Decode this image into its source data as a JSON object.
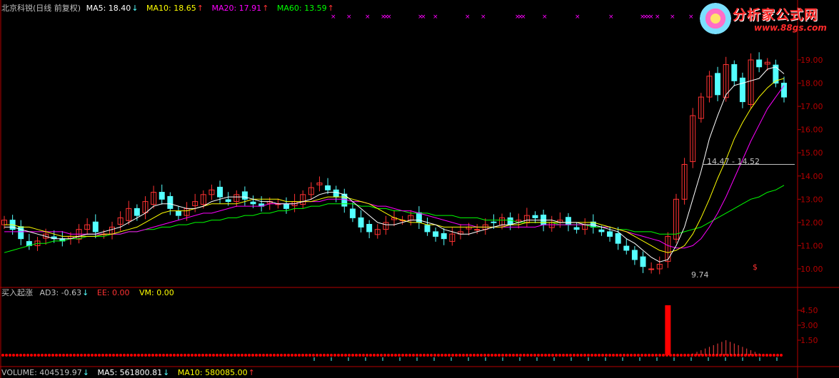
{
  "header": {
    "title": "北京科锐(日线 前复权)",
    "ma5": "MA5: 18.40",
    "ma5_arrow": "↓",
    "ma10": "MA10: 18.65",
    "ma10_arrow": "↑",
    "ma20": "MA20: 17.91",
    "ma20_arrow": "↑",
    "ma60": "MA60: 13.59",
    "ma60_arrow": "↑"
  },
  "indicator_header": {
    "name": "买入起涨",
    "ad3": "AD3: -0.63",
    "ad3_arrow": "↓",
    "ee": "EE: 0.00",
    "vm": "VM: 0.00"
  },
  "volume_header": {
    "volume": "VOLUME: 404519.97",
    "volume_arrow": "↓",
    "ma5": "MA5: 561800.81",
    "ma5_arrow": "↓",
    "ma10": "MA10: 580085.00",
    "ma10_arrow": "↑"
  },
  "logo": {
    "title": "分析家公式网",
    "url": "www.88gs.com"
  },
  "colors": {
    "ma5": "#ffffff",
    "ma10": "#ffff00",
    "ma20": "#ff00ff",
    "ma60": "#00ff00",
    "up": "#ff3232",
    "down": "#54ffff",
    "axis": "#b40000",
    "indicator": "#ff0000"
  },
  "chart_data": [
    {
      "type": "candlestick",
      "title": "北京科锐(日线 前复权)",
      "ylim": [
        9.5,
        19.8
      ],
      "y_ticks": [
        "10.00",
        "11.00",
        "12.00",
        "13.00",
        "14.00",
        "15.00",
        "16.00",
        "17.00",
        "18.00",
        "19.00"
      ],
      "annotations": {
        "low_label": "9.74",
        "gap_label": "14.47 - 14.52",
        "gap_price": 14.5,
        "signal_mark": "$"
      },
      "close": [
        12.1,
        11.7,
        11.3,
        11.0,
        11.2,
        11.5,
        11.3,
        11.2,
        11.4,
        11.7,
        11.9,
        11.6,
        11.5,
        11.8,
        12.2,
        12.6,
        12.3,
        12.9,
        13.3,
        13.0,
        12.6,
        12.3,
        12.6,
        12.9,
        13.2,
        13.4,
        13.1,
        12.9,
        13.2,
        13.0,
        12.8,
        12.7,
        12.9,
        12.8,
        12.6,
        12.9,
        13.2,
        13.5,
        13.7,
        13.4,
        13.1,
        12.7,
        12.2,
        11.8,
        11.6,
        11.7,
        12.0,
        12.2,
        12.1,
        12.3,
        12.0,
        11.6,
        11.4,
        11.3,
        11.5,
        11.6,
        11.8,
        11.7,
        11.9,
        12.0,
        12.2,
        11.9,
        12.1,
        12.3,
        12.2,
        11.9,
        12.0,
        12.1,
        11.9,
        11.7,
        11.9,
        11.8,
        11.6,
        11.4,
        11.1,
        10.8,
        10.4,
        10.1,
        10.0,
        10.2,
        11.4,
        13.0,
        14.5,
        16.6,
        17.4,
        18.3,
        17.5,
        18.8,
        18.1,
        17.2,
        19.0,
        18.7,
        18.9,
        18.0,
        17.4
      ],
      "ma5": [
        11.8,
        11.8,
        11.7,
        11.6,
        11.5,
        11.4,
        11.3,
        11.3,
        11.3,
        11.4,
        11.5,
        11.5,
        11.6,
        11.7,
        11.8,
        12.0,
        12.2,
        12.4,
        12.7,
        12.8,
        12.8,
        12.7,
        12.6,
        12.6,
        12.7,
        12.9,
        13.0,
        13.1,
        13.1,
        13.1,
        13.0,
        12.9,
        12.9,
        12.8,
        12.8,
        12.8,
        12.9,
        13.0,
        13.2,
        13.3,
        13.3,
        13.2,
        12.9,
        12.6,
        12.3,
        12.0,
        11.9,
        11.9,
        12.0,
        12.1,
        12.1,
        12.0,
        11.9,
        11.7,
        11.6,
        11.5,
        11.5,
        11.6,
        11.7,
        11.8,
        11.9,
        11.9,
        12.0,
        12.1,
        12.1,
        12.1,
        12.1,
        12.0,
        12.0,
        12.0,
        11.9,
        11.9,
        11.8,
        11.7,
        11.6,
        11.3,
        11.1,
        10.8,
        10.5,
        10.3,
        10.4,
        11.0,
        11.8,
        13.0,
        14.2,
        15.6,
        16.6,
        17.5,
        17.9,
        18.0,
        18.1,
        18.2,
        18.6,
        18.7,
        18.4
      ],
      "ma10": [
        11.9,
        11.9,
        11.8,
        11.8,
        11.7,
        11.6,
        11.5,
        11.4,
        11.4,
        11.4,
        11.4,
        11.4,
        11.5,
        11.5,
        11.6,
        11.7,
        11.8,
        12.0,
        12.2,
        12.4,
        12.5,
        12.5,
        12.5,
        12.6,
        12.7,
        12.8,
        12.8,
        12.8,
        12.8,
        12.9,
        13.0,
        13.0,
        13.0,
        13.0,
        12.9,
        12.9,
        12.9,
        12.9,
        13.0,
        13.1,
        13.1,
        13.1,
        13.0,
        12.9,
        12.8,
        12.6,
        12.4,
        12.2,
        12.1,
        12.0,
        12.0,
        11.9,
        11.9,
        11.8,
        11.8,
        11.8,
        11.8,
        11.8,
        11.8,
        11.8,
        11.8,
        11.9,
        11.9,
        12.0,
        12.0,
        12.0,
        12.0,
        12.0,
        12.0,
        12.0,
        12.0,
        12.0,
        11.9,
        11.8,
        11.7,
        11.6,
        11.4,
        11.2,
        11.0,
        10.8,
        10.7,
        10.8,
        11.0,
        11.5,
        12.2,
        13.0,
        13.9,
        14.7,
        15.6,
        16.3,
        16.9,
        17.4,
        17.8,
        18.1,
        18.2
      ],
      "ma20": [
        11.6,
        11.6,
        11.6,
        11.6,
        11.6,
        11.6,
        11.6,
        11.6,
        11.5,
        11.5,
        11.5,
        11.5,
        11.5,
        11.5,
        11.5,
        11.6,
        11.6,
        11.7,
        11.8,
        11.9,
        12.0,
        12.1,
        12.2,
        12.3,
        12.4,
        12.4,
        12.5,
        12.6,
        12.7,
        12.7,
        12.7,
        12.7,
        12.8,
        12.8,
        12.8,
        12.8,
        12.9,
        12.9,
        12.9,
        13.0,
        13.0,
        13.0,
        12.9,
        12.9,
        12.8,
        12.7,
        12.7,
        12.6,
        12.5,
        12.5,
        12.4,
        12.3,
        12.2,
        12.1,
        12.0,
        11.9,
        11.9,
        11.8,
        11.8,
        11.8,
        11.8,
        11.8,
        11.8,
        11.8,
        11.8,
        11.9,
        11.9,
        11.9,
        11.9,
        11.9,
        11.9,
        11.9,
        11.8,
        11.8,
        11.7,
        11.6,
        11.5,
        11.4,
        11.3,
        11.2,
        11.0,
        10.9,
        10.9,
        11.0,
        11.3,
        11.8,
        12.4,
        13.1,
        13.9,
        14.7,
        15.5,
        16.2,
        16.9,
        17.4,
        17.9
      ],
      "ma60": [
        10.7,
        10.8,
        10.9,
        11.0,
        11.1,
        11.1,
        11.2,
        11.2,
        11.3,
        11.3,
        11.4,
        11.4,
        11.4,
        11.5,
        11.5,
        11.6,
        11.6,
        11.7,
        11.7,
        11.8,
        11.8,
        11.9,
        11.9,
        12.0,
        12.0,
        12.1,
        12.1,
        12.2,
        12.2,
        12.3,
        12.3,
        12.4,
        12.4,
        12.5,
        12.5,
        12.6,
        12.6,
        12.7,
        12.7,
        12.8,
        12.8,
        12.8,
        12.8,
        12.7,
        12.7,
        12.6,
        12.6,
        12.5,
        12.5,
        12.4,
        12.4,
        12.4,
        12.3,
        12.3,
        12.3,
        12.2,
        12.2,
        12.2,
        12.1,
        12.1,
        12.1,
        12.1,
        12.0,
        12.0,
        12.0,
        12.0,
        12.0,
        11.9,
        11.9,
        11.9,
        11.9,
        11.8,
        11.8,
        11.8,
        11.7,
        11.7,
        11.6,
        11.6,
        11.6,
        11.5,
        11.5,
        11.5,
        11.6,
        11.7,
        11.8,
        12.0,
        12.2,
        12.4,
        12.6,
        12.8,
        13.0,
        13.1,
        13.3,
        13.4,
        13.6
      ]
    },
    {
      "type": "bar",
      "title": "买入起涨",
      "ylim": [
        0,
        5.5
      ],
      "y_ticks": [
        "1.50",
        "3.00",
        "4.50"
      ],
      "series": [
        {
          "name": "AD3",
          "spike_index": 80,
          "spike_value": 5.0,
          "hump_center_index": 87,
          "hump_peak": 1.5
        }
      ],
      "baseline": 0
    }
  ]
}
